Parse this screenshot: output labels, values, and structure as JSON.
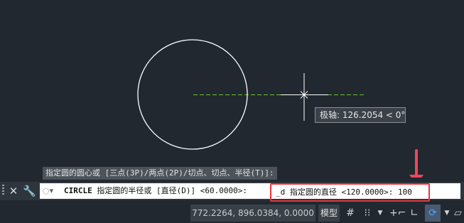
{
  "colors": {
    "canvas_bg": "#212830",
    "circle": "#ffffff",
    "tracking_line": "#6fbf2f",
    "highlight_border": "#e8343c",
    "callout_arrow": "#f0465a"
  },
  "canvas": {
    "tooltip": "极轴: 126.2054 < 0°"
  },
  "command_history": {
    "line": "指定圆的圆心或 [三点(3P)/两点(2P)/切点、切点、半径(T)]:"
  },
  "command_line": {
    "close_icon": "close-icon",
    "settings_icon": "wrench-icon",
    "recent_icon": "recent-commands-icon",
    "command_name": "CIRCLE",
    "prompt": "指定圆的半径或 [直径(D)] <60.0000>: ",
    "typed_option": "_d 指定圆的直径 <120.0000>: 100"
  },
  "status_bar": {
    "coordinates": "772.2264, 896.0384, 0.0000",
    "model_tab": "模型",
    "icons": [
      "grid-icon",
      "snap-icon",
      "ortho-icon",
      "infer-constraints-icon",
      "polar-tracking-icon"
    ]
  }
}
